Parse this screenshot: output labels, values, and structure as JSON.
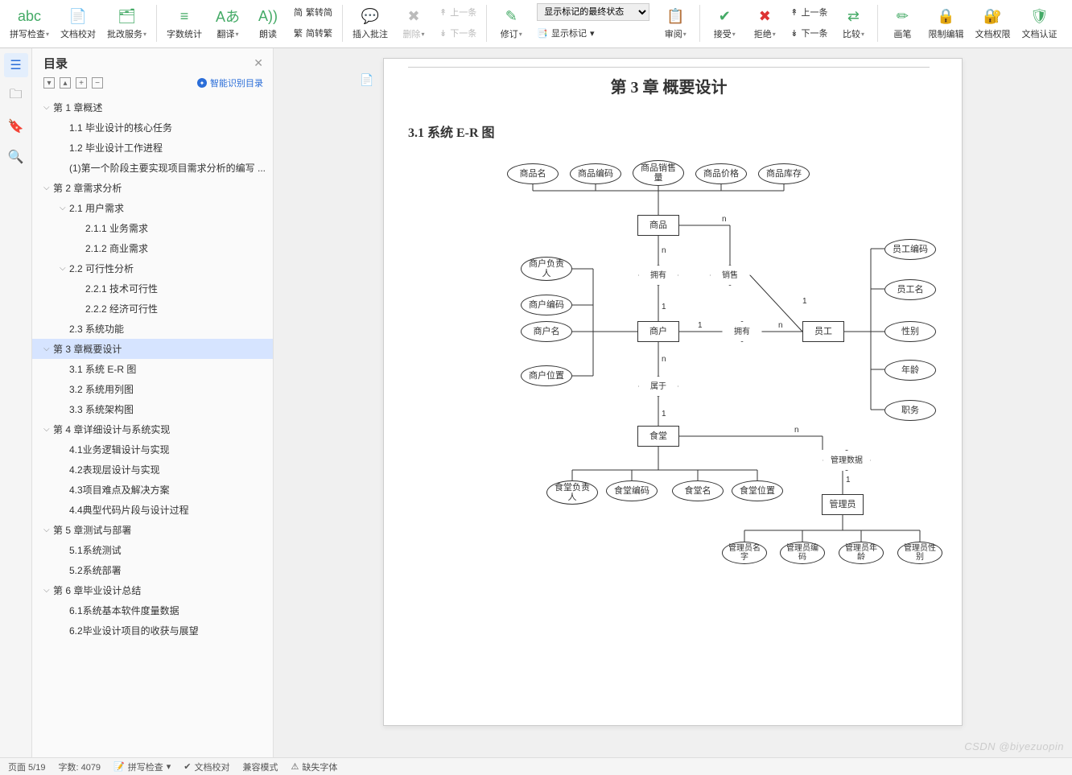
{
  "ribbon": {
    "spell": "拼写检查",
    "proof": "文档校对",
    "batch": "批改服务",
    "wc": "字数统计",
    "trans": "翻译",
    "read": "朗读",
    "tc1": "繁转简",
    "tc2": "简转繁",
    "comment": "插入批注",
    "del": "删除",
    "prev": "上一条",
    "next": "下一条",
    "revise": "修订",
    "showstate": "显示标记的最终状态",
    "showmark": "显示标记",
    "review": "审阅",
    "accept": "接受",
    "reject": "拒绝",
    "prev2": "上一条",
    "next2": "下一条",
    "compare": "比较",
    "pen": "画笔",
    "restrict": "限制编辑",
    "perm": "文档权限",
    "auth": "文档认证"
  },
  "toc": {
    "title": "目录",
    "smart": "智能识别目录",
    "items": [
      {
        "l": 1,
        "t": "第 1 章概述",
        "c": 1
      },
      {
        "l": 2,
        "t": "1.1 毕业设计的核心任务"
      },
      {
        "l": 2,
        "t": "1.2 毕业设计工作进程"
      },
      {
        "l": 2,
        "t": "(1)第一个阶段主要实现项目需求分析的编写 ..."
      },
      {
        "l": 1,
        "t": "第 2 章需求分析",
        "c": 1
      },
      {
        "l": 2,
        "t": "2.1 用户需求",
        "c": 1
      },
      {
        "l": 3,
        "t": "2.1.1 业务需求"
      },
      {
        "l": 3,
        "t": "2.1.2 商业需求"
      },
      {
        "l": 2,
        "t": "2.2 可行性分析",
        "c": 1
      },
      {
        "l": 3,
        "t": "2.2.1 技术可行性"
      },
      {
        "l": 3,
        "t": "2.2.2 经济可行性"
      },
      {
        "l": 2,
        "t": "2.3 系统功能"
      },
      {
        "l": 1,
        "t": "第 3 章概要设计",
        "c": 1,
        "active": 1
      },
      {
        "l": 2,
        "t": "3.1 系统 E-R 图"
      },
      {
        "l": 2,
        "t": "3.2 系统用列图"
      },
      {
        "l": 2,
        "t": "3.3 系统架构图"
      },
      {
        "l": 1,
        "t": "第 4 章详细设计与系统实现",
        "c": 1
      },
      {
        "l": 2,
        "t": "4.1业务逻辑设计与实现"
      },
      {
        "l": 2,
        "t": "4.2表现层设计与实现"
      },
      {
        "l": 2,
        "t": "4.3项目难点及解决方案"
      },
      {
        "l": 2,
        "t": "4.4典型代码片段与设计过程"
      },
      {
        "l": 1,
        "t": "第 5 章测试与部署",
        "c": 1
      },
      {
        "l": 2,
        "t": "5.1系统测试"
      },
      {
        "l": 2,
        "t": "5.2系统部署"
      },
      {
        "l": 1,
        "t": "第 6 章毕业设计总结",
        "c": 1
      },
      {
        "l": 2,
        "t": "6.1系统基本软件度量数据"
      },
      {
        "l": 2,
        "t": "6.2毕业设计项目的收获与展望"
      }
    ]
  },
  "doc": {
    "chapter": "第 3 章 概要设计",
    "section": "3.1 系统 E-R 图",
    "er": {
      "product_attrs": [
        "商品名",
        "商品编码",
        "商品销售量",
        "商品价格",
        "商品库存"
      ],
      "product": "商品",
      "owns": "拥有",
      "sells": "销售",
      "merchant": "商户",
      "merchant_attrs": [
        "商户负责人",
        "商户编码",
        "商户名",
        "商户位置"
      ],
      "has": "拥有",
      "employee": "员工",
      "employee_attrs": [
        "员工编码",
        "员工名",
        "性别",
        "年龄",
        "职务"
      ],
      "belongs": "属于",
      "canteen": "食堂",
      "canteen_attrs": [
        "食堂负责人",
        "食堂编码",
        "食堂名",
        "食堂位置"
      ],
      "manage": "管理数据",
      "admin": "管理员",
      "admin_attrs": [
        "管理员名字",
        "管理员编码",
        "管理员年龄",
        "管理员性别"
      ],
      "card": {
        "1": "1",
        "n": "n"
      }
    }
  },
  "status": {
    "page": "页面 5/19",
    "wc": "字数: 4079",
    "spell": "拼写检查",
    "proof": "文档校对",
    "mode": "兼容模式",
    "other": "缺失字体"
  },
  "watermark": "CSDN @biyezuopin"
}
